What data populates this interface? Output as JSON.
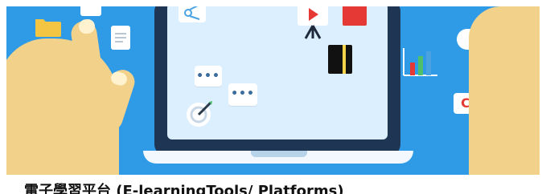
{
  "caption": "電子學習平台 (E-learningTools/ Platforms)",
  "colors": {
    "background": "#2f9ae6",
    "laptop_bezel": "#1e3554",
    "screen": "#dcefff",
    "skin": "#f2d28a",
    "red": "#e53935"
  },
  "icons": [
    "folder-icon",
    "document-icon",
    "scissors-icon",
    "video-play-icon",
    "red-book-icon",
    "black-notebook-icon",
    "chat-bubble-icon",
    "target-icon",
    "bar-chart-icon"
  ]
}
